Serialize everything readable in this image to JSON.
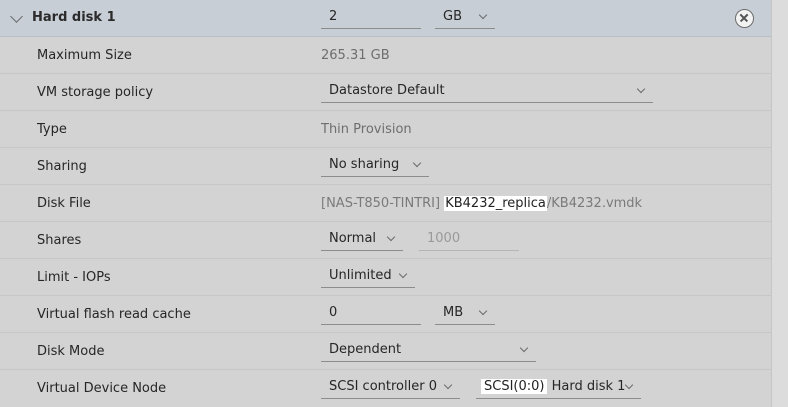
{
  "header": {
    "title": "Hard disk 1",
    "size_value": "2",
    "size_unit": "GB"
  },
  "rows": {
    "max_size": {
      "label": "Maximum Size",
      "value": "265.31 GB"
    },
    "storage_policy": {
      "label": "VM storage policy",
      "value": "Datastore Default"
    },
    "type": {
      "label": "Type",
      "value": "Thin Provision"
    },
    "sharing": {
      "label": "Sharing",
      "value": "No sharing"
    },
    "disk_file": {
      "label": "Disk File",
      "prefix": "[NAS-T850-TINTRI]",
      "highlight": "KB4232_replica",
      "suffix": "/KB4232.vmdk"
    },
    "shares": {
      "label": "Shares",
      "value": "Normal",
      "number": "1000"
    },
    "limit_iops": {
      "label": "Limit - IOPs",
      "value": "Unlimited"
    },
    "flash_cache": {
      "label": "Virtual flash read cache",
      "value": "0",
      "unit": "MB"
    },
    "disk_mode": {
      "label": "Disk Mode",
      "value": "Dependent"
    },
    "device_node": {
      "label": "Virtual Device Node",
      "controller": "SCSI controller 0",
      "node_highlight": "SCSI(0:0)",
      "node_suffix": "Hard disk 1"
    }
  }
}
